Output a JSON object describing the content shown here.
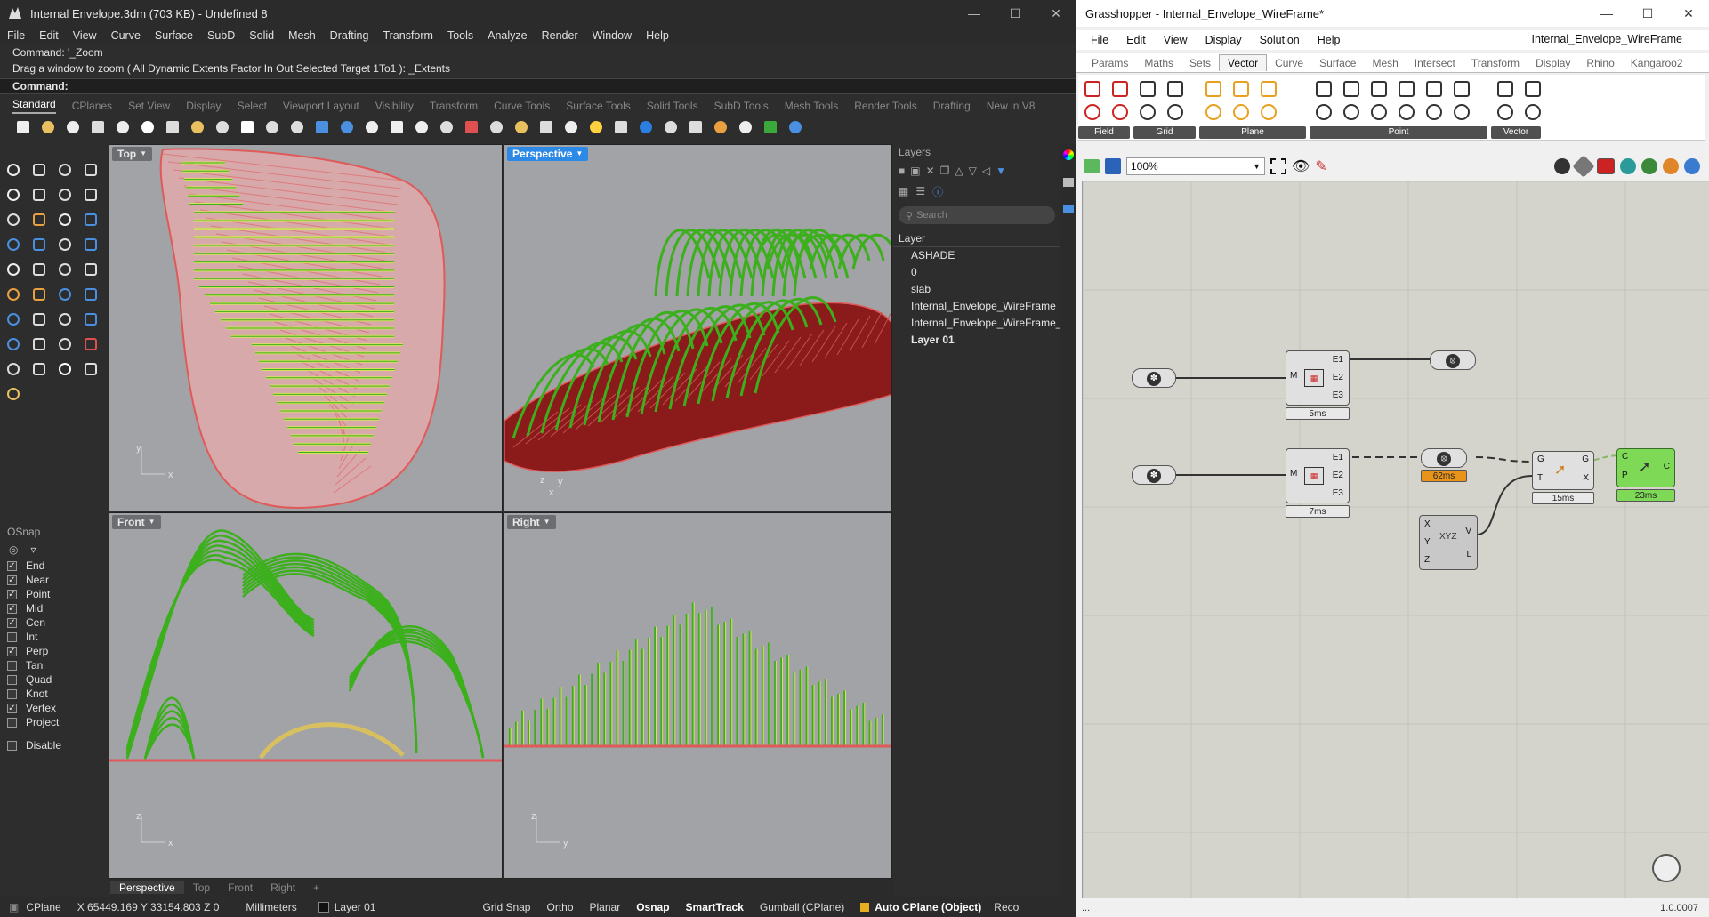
{
  "rhino": {
    "title": "Internal Envelope.3dm (703 KB) - Undefined 8",
    "menu": [
      "File",
      "Edit",
      "View",
      "Curve",
      "Surface",
      "SubD",
      "Solid",
      "Mesh",
      "Drafting",
      "Transform",
      "Tools",
      "Analyze",
      "Render",
      "Window",
      "Help"
    ],
    "command_history": [
      "Command: '_Zoom",
      "Drag a window to zoom ( All  Dynamic  Extents  Factor  In  Out  Selected  Target  1To1 ): _Extents"
    ],
    "command_prompt": "Command:",
    "toolbar_tabs": [
      "Standard",
      "CPlanes",
      "Set View",
      "Display",
      "Select",
      "Viewport Layout",
      "Visibility",
      "Transform",
      "Curve Tools",
      "Surface Tools",
      "Solid Tools",
      "SubD Tools",
      "Mesh Tools",
      "Render Tools",
      "Drafting",
      "New in V8"
    ],
    "active_tab": "Standard",
    "viewports": {
      "top": {
        "label": "Top",
        "axes": [
          "y",
          "x"
        ]
      },
      "perspective": {
        "label": "Perspective",
        "axes": [
          "z",
          "y",
          "x"
        ]
      },
      "front": {
        "label": "Front",
        "axes": [
          "z",
          "x"
        ]
      },
      "right": {
        "label": "Right",
        "axes": [
          "z",
          "y"
        ]
      }
    },
    "viewport_tabs": [
      "Perspective",
      "Top",
      "Front",
      "Right",
      "+"
    ],
    "osnap": {
      "header": "OSnap",
      "items": [
        {
          "label": "End",
          "checked": true
        },
        {
          "label": "Near",
          "checked": true
        },
        {
          "label": "Point",
          "checked": true
        },
        {
          "label": "Mid",
          "checked": true
        },
        {
          "label": "Cen",
          "checked": true
        },
        {
          "label": "Int",
          "checked": false
        },
        {
          "label": "Perp",
          "checked": true
        },
        {
          "label": "Tan",
          "checked": false
        },
        {
          "label": "Quad",
          "checked": false
        },
        {
          "label": "Knot",
          "checked": false
        },
        {
          "label": "Vertex",
          "checked": true
        },
        {
          "label": "Project",
          "checked": false
        }
      ],
      "disable": "Disable"
    },
    "layers": {
      "header": "Layers",
      "search_placeholder": "Search",
      "column": "Layer",
      "items": [
        "ASHADE",
        "0",
        "slab",
        "Internal_Envelope_WireFrame",
        "Internal_Envelope_WireFrame_",
        "Layer 01"
      ],
      "current": "Layer 01"
    },
    "status": {
      "cplane": "CPlane",
      "coords": "X 65449.169 Y 33154.803 Z 0",
      "units": "Millimeters",
      "layer": "Layer 01",
      "grid_snap": "Grid Snap",
      "ortho": "Ortho",
      "planar": "Planar",
      "osnap": "Osnap",
      "smarttrack": "SmartTrack",
      "gumball": "Gumball (CPlane)",
      "auto_cplane": "Auto CPlane (Object)",
      "record": "Reco"
    },
    "colors": {
      "curve_green": "#3cb01c",
      "curve_yellow": "#d8e060",
      "surface_red": "#e05a5a",
      "slab_dark": "#8b1a1a",
      "viewport_bg": "#a1a3a6"
    }
  },
  "gh": {
    "title": "Grasshopper - Internal_Envelope_WireFrame*",
    "document": "Internal_Envelope_WireFrame",
    "menu": [
      "File",
      "Edit",
      "View",
      "Display",
      "Solution",
      "Help"
    ],
    "tabs": [
      "Params",
      "Maths",
      "Sets",
      "Vector",
      "Curve",
      "Surface",
      "Mesh",
      "Intersect",
      "Transform",
      "Display",
      "Rhino",
      "Kangaroo2"
    ],
    "active_tab": "Vector",
    "ribbon_groups": [
      "Field",
      "Grid",
      "Plane",
      "Point",
      "Vector"
    ],
    "zoom": "100%",
    "components": {
      "deconstruct1": {
        "inputs": [
          "M"
        ],
        "outputs": [
          "E1",
          "E2",
          "E3"
        ],
        "timer": "5ms"
      },
      "deconstruct2": {
        "inputs": [
          "M"
        ],
        "outputs": [
          "E1",
          "E2",
          "E3"
        ],
        "timer": "7ms"
      },
      "param_timer": "62ms",
      "transform": {
        "inputs": [
          "G",
          "T"
        ],
        "outputs": [
          "G",
          "X"
        ],
        "timer": "15ms"
      },
      "vector_xyz": {
        "inputs": [
          "X",
          "Y",
          "Z"
        ],
        "outputs": [
          "V",
          "L"
        ]
      },
      "green_comp": {
        "inputs": [
          "C",
          "P"
        ],
        "outputs": [
          "C"
        ],
        "timer": "23ms"
      }
    },
    "status_left": "...",
    "version": "1.0.0007"
  }
}
